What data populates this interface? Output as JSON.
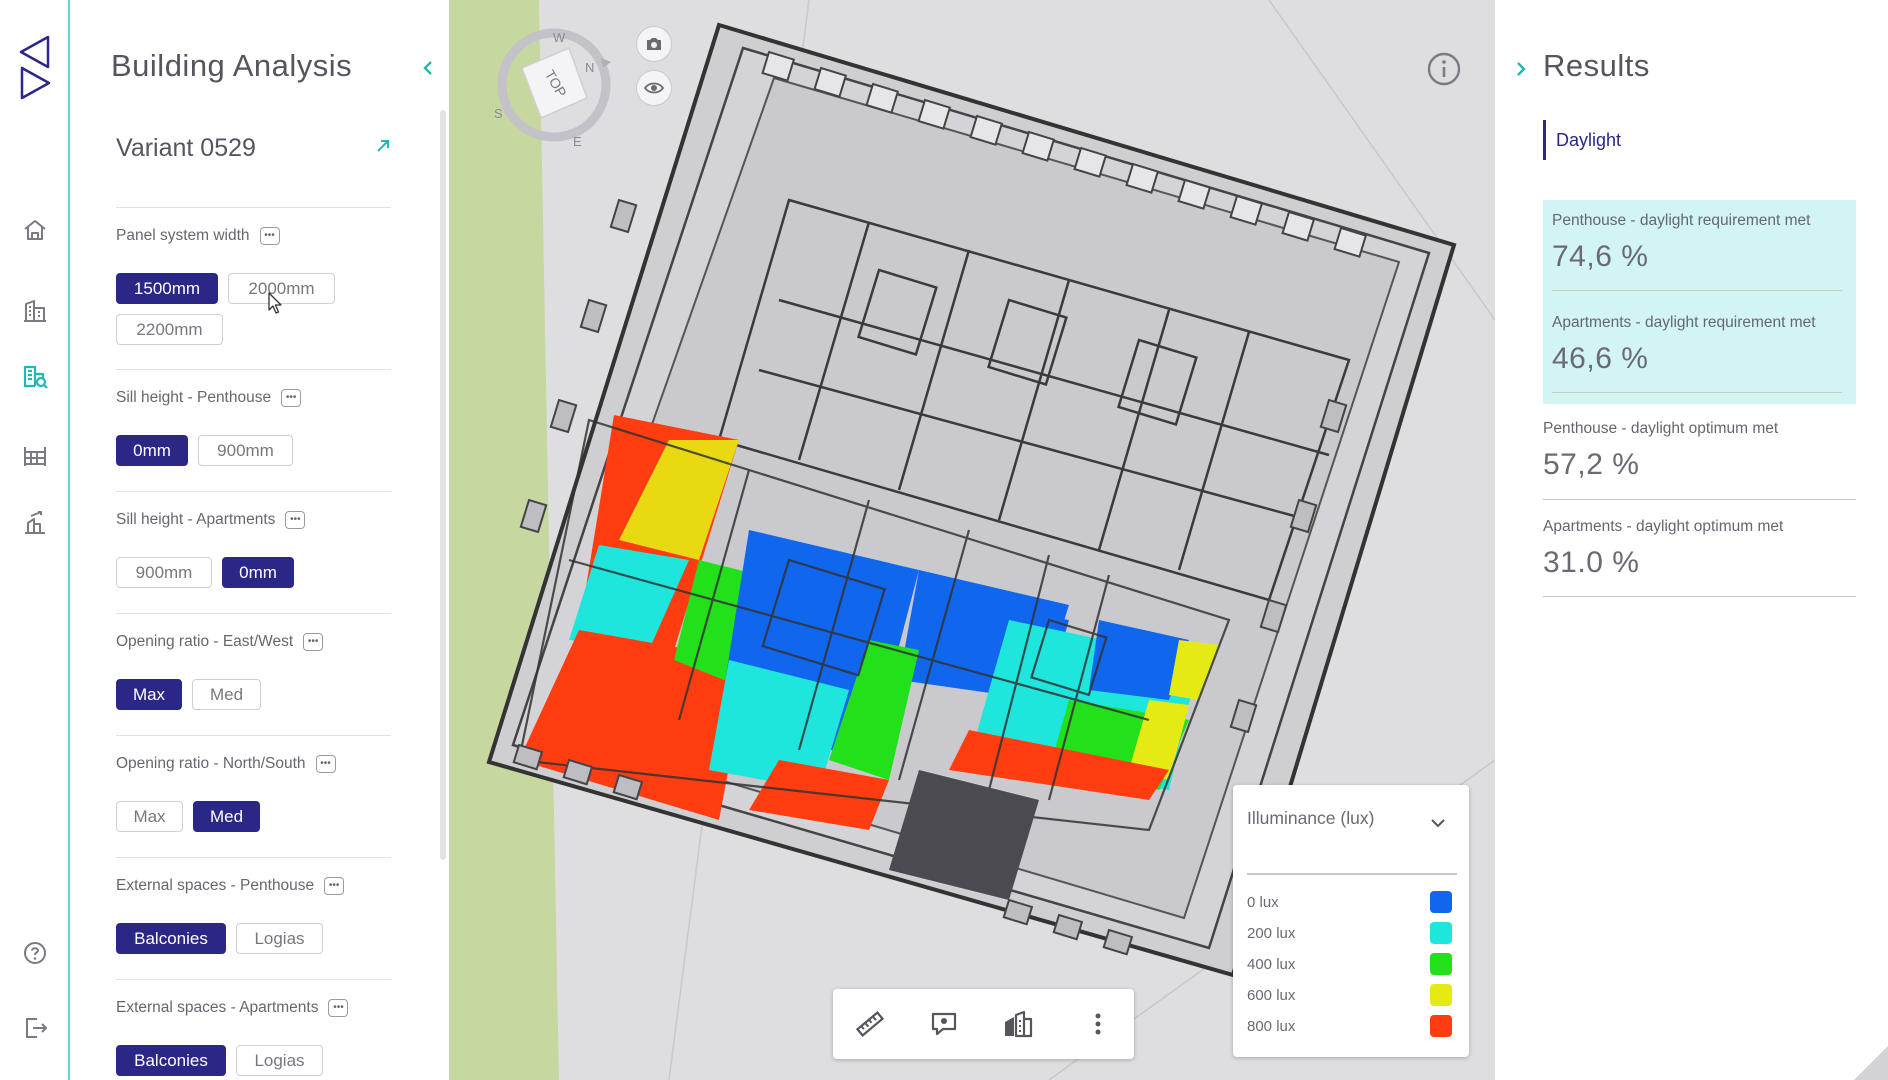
{
  "app": {
    "accent_color": "#2b2787",
    "highlight_color": "#5fd4cf"
  },
  "rail": {
    "items": [
      {
        "icon": "home-icon"
      },
      {
        "icon": "buildings-icon"
      },
      {
        "icon": "building-analysis-icon",
        "active": true
      },
      {
        "icon": "facade-panel-icon"
      },
      {
        "icon": "site-icon"
      }
    ],
    "help_icon": "help-icon",
    "logout_icon": "logout-icon"
  },
  "left_panel": {
    "title": "Building Analysis",
    "variant": "Variant 0529",
    "sections": [
      {
        "label": "Panel system width",
        "options": [
          "1500mm",
          "2000mm",
          "2200mm"
        ],
        "selected": "1500mm"
      },
      {
        "label": "Sill height - Penthouse",
        "options": [
          "0mm",
          "900mm"
        ],
        "selected": "0mm"
      },
      {
        "label": "Sill height - Apartments",
        "options": [
          "900mm",
          "0mm"
        ],
        "selected": "0mm"
      },
      {
        "label": "Opening ratio - East/West",
        "options": [
          "Max",
          "Med"
        ],
        "selected": "Max"
      },
      {
        "label": "Opening ratio - North/South",
        "options": [
          "Max",
          "Med"
        ],
        "selected": "Med"
      },
      {
        "label": "External spaces - Penthouse",
        "options": [
          "Balconies",
          "Logias"
        ],
        "selected": "Balconies"
      },
      {
        "label": "External spaces - Apartments",
        "options": [
          "Balconies",
          "Logias"
        ],
        "selected": "Balconies"
      }
    ]
  },
  "viewport": {
    "compass": {
      "cube_label": "TOP",
      "n": "N",
      "e": "E",
      "s": "S",
      "w": "W"
    },
    "legend": {
      "title": "Illuminance (lux)",
      "items": [
        {
          "label": "0 lux",
          "color": "#1166ee"
        },
        {
          "label": "200 lux",
          "color": "#1ee6dc"
        },
        {
          "label": "400 lux",
          "color": "#22e01a"
        },
        {
          "label": "600 lux",
          "color": "#e6ea14"
        },
        {
          "label": "800 lux",
          "color": "#ff3d10"
        }
      ]
    },
    "toolbar": [
      "ruler-icon",
      "comment-view-icon",
      "building-scene-icon",
      "more-vertical-icon"
    ]
  },
  "results": {
    "title": "Results",
    "tab": "Daylight",
    "metrics": [
      {
        "label": "Penthouse - daylight requirement met",
        "value": "74,6 %",
        "highlighted": true
      },
      {
        "label": "Apartments - daylight requirement met",
        "value": "46,6 %",
        "highlighted": true
      },
      {
        "label": "Penthouse - daylight optimum met",
        "value": "57,2 %",
        "highlighted": false
      },
      {
        "label": "Apartments - daylight optimum met",
        "value": "31.0 %",
        "highlighted": false
      }
    ]
  }
}
